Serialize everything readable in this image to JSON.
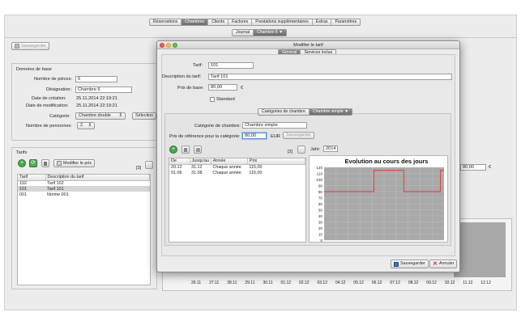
{
  "top_tabs": [
    "Réservations",
    "Chambres",
    "Clients",
    "Factures",
    "Prestations supplémentaires",
    "Extras",
    "Paramètres"
  ],
  "top_tab_selected": 1,
  "sub_tabs": {
    "journal": "Journal",
    "chambre": "Chambre 6 ▼"
  },
  "toolbar": {
    "save_label": "Sauvegarder"
  },
  "base": {
    "title": "Données de base",
    "pieces_label": "Nombre de pièces:",
    "pieces": "6",
    "designation_label": "Désignation:",
    "designation": "Chambre 6",
    "creation_label": "Date de création:",
    "creation": "25.11.2014 22:19:21",
    "modification_label": "Date de modification:",
    "modification": "25.11.2014 22:19:21",
    "categorie_label": "Catégorie:",
    "categorie": "Chambre double",
    "selection_label": "Sélection",
    "personnes_label": "Nombre de personnes:",
    "personnes": "2"
  },
  "tarifs": {
    "title": "Tarifs",
    "modify_label": "Modifier le prix",
    "count": "[3]",
    "columns": [
      "Tarif",
      "Description du tarif"
    ],
    "rows": [
      [
        "102",
        "Tarif 102"
      ],
      [
        "101",
        "Tarif 101"
      ],
      [
        "001",
        "Norme 001"
      ]
    ],
    "selected_row": 1
  },
  "background_price": "80,00",
  "background_currency": "€",
  "background_dates": [
    "26.11",
    "27.11",
    "28.11",
    "29.11",
    "30.11",
    "01.12",
    "02.12",
    "03.12",
    "04.12",
    "05.12",
    "06.12",
    "07.12",
    "08.12",
    "09.12",
    "10.12",
    "11.12",
    "12.12"
  ],
  "dialog": {
    "title": "Modifier le tarif",
    "tabs": [
      "Général",
      "Services inclus"
    ],
    "tarif_label": "Tarif:",
    "tarif": "101",
    "description_label": "Description du tarif:",
    "description": "Tarif 101",
    "prix_base_label": "Prix de base:",
    "prix_base": "80,00",
    "currency": "€",
    "standard_label": "Standard",
    "inner_tabs": {
      "categories": "Catégories de chambre",
      "simple": "Chambre simple ▼"
    },
    "categorie_label": "Catégorie de chambre:",
    "categorie": "Chambre simple",
    "ref_label": "Prix de référence pour la catégorie:",
    "ref_price": "80,00",
    "ref_currency": "EUR",
    "ref_save_label": "Sauvegarder",
    "count": "[2]",
    "year_label": "Jahr:",
    "year": "2014",
    "table": {
      "columns": [
        "De",
        "Jusqu'au",
        "Année",
        "Prix"
      ],
      "rows": [
        [
          "20.12",
          "31.12",
          "Chaque année",
          "115,00"
        ],
        [
          "01.06",
          "31.08",
          "Chaque année",
          "115,00"
        ]
      ]
    },
    "save_label": "Sauvegarder",
    "cancel_label": "Annuler"
  },
  "chart_data": {
    "type": "line",
    "title": "Evolution au cours des jours",
    "ylim": [
      0,
      120
    ],
    "yticks": [
      0,
      10,
      20,
      30,
      40,
      50,
      60,
      70,
      80,
      90,
      100,
      110,
      120
    ],
    "xlim": [
      1,
      365
    ],
    "grid": true,
    "series": [
      {
        "x": [
          1,
          152,
          152,
          243,
          243,
          354,
          354,
          365
        ],
        "values": [
          80,
          80,
          115,
          115,
          80,
          80,
          115,
          115
        ]
      }
    ],
    "colors": {
      "line": "#e8353a",
      "plot_bg": "#a9a9a9"
    }
  }
}
